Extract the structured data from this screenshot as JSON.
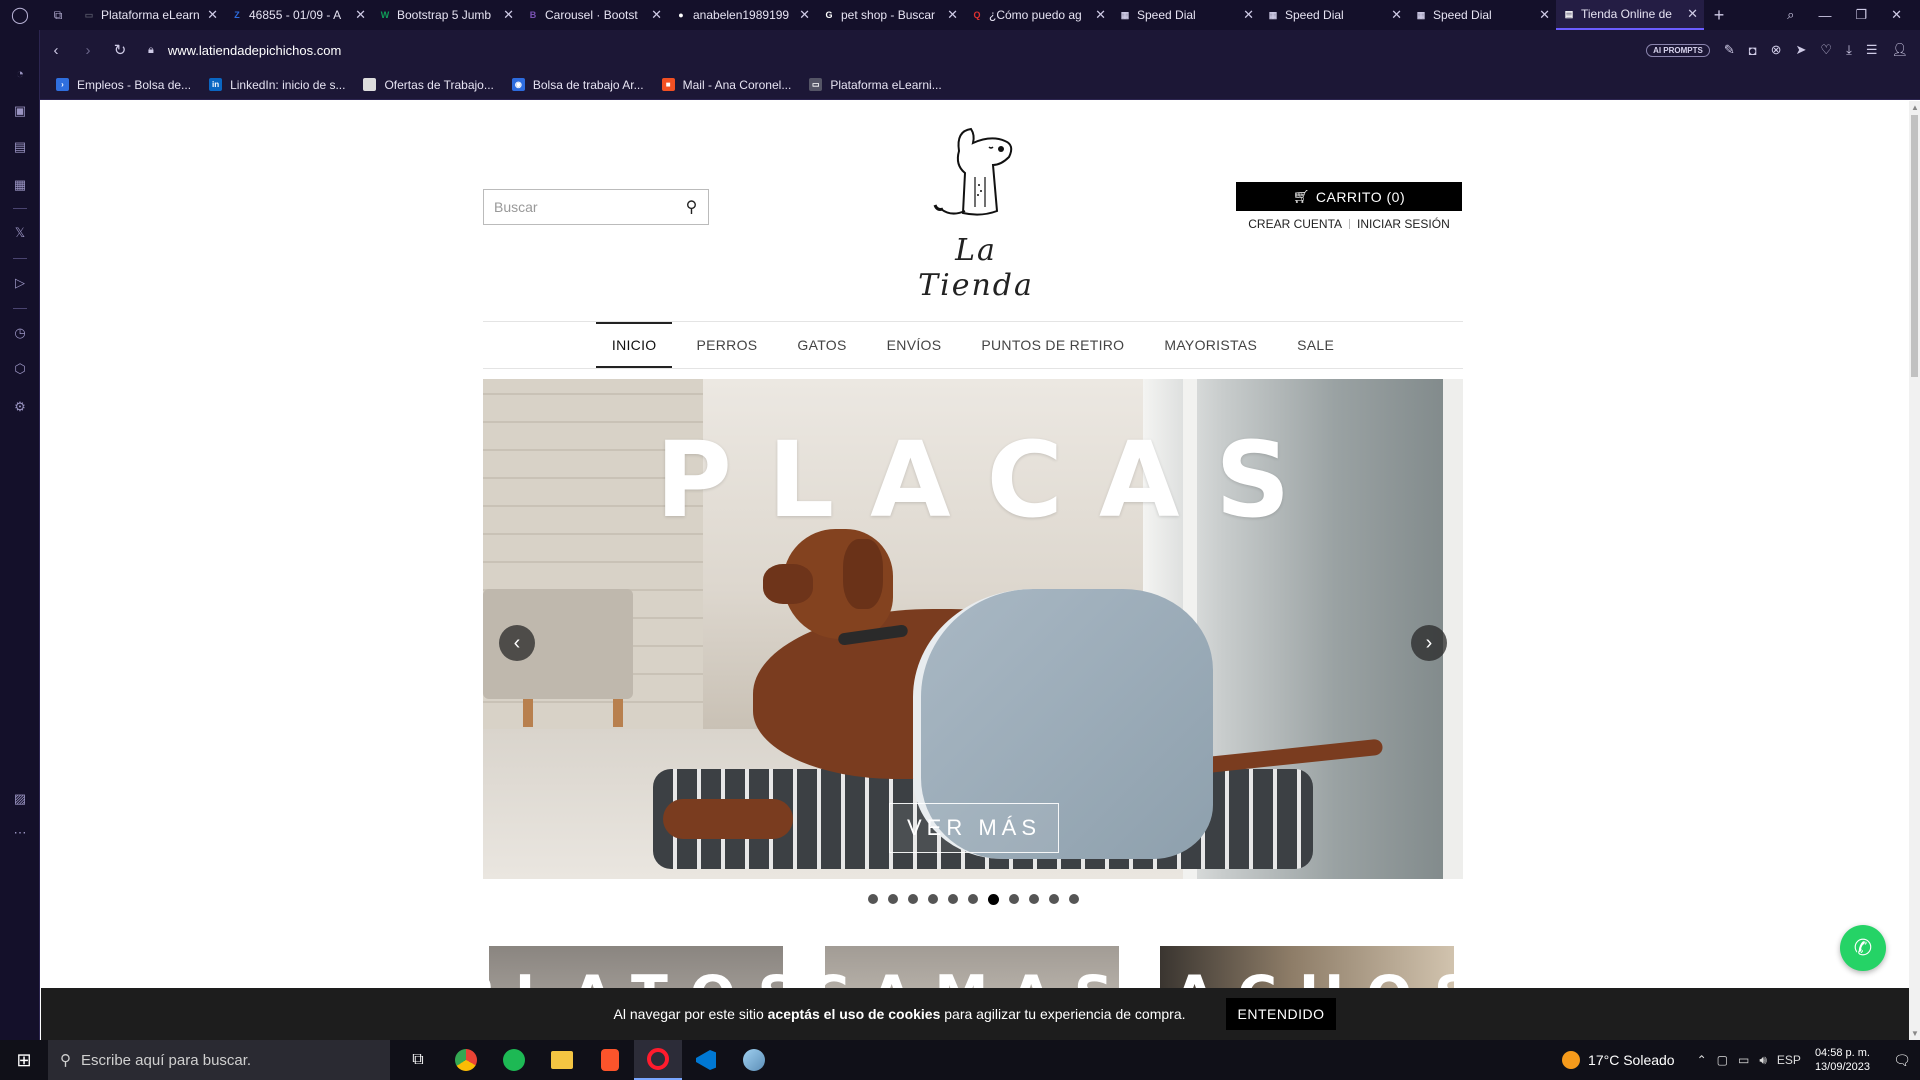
{
  "browser": {
    "tabs": [
      {
        "title": "Plataforma eLearn",
        "color": "#555566",
        "glyph": "▭"
      },
      {
        "title": "46855 - 01/09 - A",
        "color": "#2d6cdf",
        "glyph": "Z"
      },
      {
        "title": "Bootstrap 5 Jumb",
        "color": "#0f9d58",
        "glyph": "W"
      },
      {
        "title": "Carousel · Bootst",
        "color": "#7952b3",
        "glyph": "B"
      },
      {
        "title": "anabelen1989199",
        "color": "#ffffff",
        "glyph": "●"
      },
      {
        "title": "pet shop - Buscar",
        "color": "#ffffff",
        "glyph": "G"
      },
      {
        "title": "¿Cómo puedo ag",
        "color": "#e0312f",
        "glyph": "Q"
      },
      {
        "title": "Speed Dial",
        "color": "#cfcbe6",
        "glyph": "▦"
      },
      {
        "title": "Speed Dial",
        "color": "#cfcbe6",
        "glyph": "▦"
      },
      {
        "title": "Speed Dial",
        "color": "#cfcbe6",
        "glyph": "▦"
      },
      {
        "title": "Tienda Online de",
        "color": "#ffffff",
        "glyph": "▤"
      }
    ],
    "url": "www.latiendadepichichos.com",
    "ai_prompts": "AI PROMPTS",
    "bookmarks": [
      {
        "label": "Empleos - Bolsa de...",
        "color": "#2f6fde",
        "glyph": "›"
      },
      {
        "label": "LinkedIn: inicio de s...",
        "color": "#0a66c2",
        "glyph": "in"
      },
      {
        "label": "Ofertas de Trabajo...",
        "color": "#dddddd",
        "glyph": ""
      },
      {
        "label": "Bolsa de trabajo Ar...",
        "color": "#2d6cdf",
        "glyph": "◉"
      },
      {
        "label": "Mail - Ana Coronel...",
        "color": "#f25022",
        "glyph": "■"
      },
      {
        "label": "Plataforma eLearni...",
        "color": "#555566",
        "glyph": "▭"
      }
    ]
  },
  "store": {
    "search_placeholder": "Buscar",
    "logo_text": "La Tienda",
    "cart_label": "CARRITO (0)",
    "create_account": "CREAR CUENTA",
    "login": "INICIAR SESIÓN",
    "nav": [
      "INICIO",
      "PERROS",
      "GATOS",
      "ENVÍOS",
      "PUNTOS DE RETIRO",
      "MAYORISTAS",
      "SALE"
    ],
    "active_nav": "INICIO",
    "hero": {
      "title": "PLACAS",
      "cta": "VER MÁS",
      "slide_count": 11,
      "active_slide": 6
    },
    "categories": [
      "PLATOS",
      "CAMAS",
      "TACHOS"
    ],
    "cookie": {
      "text_before": "Al navegar por este sitio ",
      "text_bold": "aceptás el uso de cookies",
      "text_after": " para agilizar tu experiencia de compra.",
      "button": "ENTENDIDO"
    }
  },
  "taskbar": {
    "search_placeholder": "Escribe aquí para buscar.",
    "weather": "17°C  Soleado",
    "language": "ESP",
    "time": "04:58 p. m.",
    "date": "13/09/2023"
  },
  "colors": {
    "chrome_bg": "#14102a",
    "accent": "#6b5cff",
    "whatsapp": "#25d366"
  }
}
